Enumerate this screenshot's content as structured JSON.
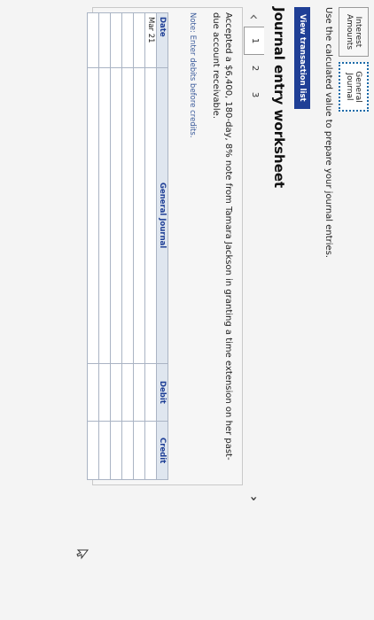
{
  "tabs": [
    {
      "line1": "Interest",
      "line2": "Amounts",
      "active": false
    },
    {
      "line1": "General",
      "line2": "Journal",
      "active": true
    }
  ],
  "instruction": "Use the calculated value to prepare your journal entries.",
  "view_button": "View transaction list",
  "worksheet_title": "Journal entry worksheet",
  "pager": {
    "pages": [
      "1",
      "2",
      "3"
    ],
    "current": "1"
  },
  "description": "Accepted a $6,400, 180-day, 8% note from Tamara Jackson in granting a time extension on her past-due account receivable.",
  "note": "Note: Enter debits before credits.",
  "table": {
    "headers": {
      "date": "Date",
      "general_journal": "General Journal",
      "debit": "Debit",
      "credit": "Credit"
    },
    "first_date": "Mar 21",
    "row_count": 6
  }
}
